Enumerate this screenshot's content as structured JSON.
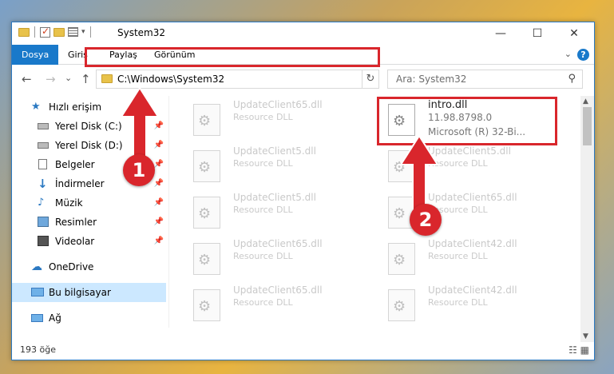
{
  "window": {
    "title": "System32",
    "minimize": "—",
    "maximize": "☐",
    "close": "✕"
  },
  "ribbon": {
    "tabs": [
      "Dosya",
      "Giriş",
      "Paylaş",
      "Görünüm"
    ],
    "help": "?"
  },
  "nav": {
    "back": "←",
    "forward": "→",
    "recent": "⌄",
    "up": "↑",
    "address": "C:\\Windows\\System32",
    "search_placeholder": "Ara: System32"
  },
  "sidebar": {
    "items": [
      {
        "label": "Hızlı erişim",
        "icon": "star-icon",
        "pinned": false
      },
      {
        "label": "Yerel Disk (C:)",
        "icon": "drive-icon",
        "pinned": true
      },
      {
        "label": "Yerel Disk (D:)",
        "icon": "drive-icon",
        "pinned": true
      },
      {
        "label": "Belgeler",
        "icon": "document-icon",
        "pinned": true
      },
      {
        "label": "İndirmeler",
        "icon": "download-icon",
        "pinned": true
      },
      {
        "label": "Müzik",
        "icon": "music-icon",
        "pinned": true
      },
      {
        "label": "Resimler",
        "icon": "pictures-icon",
        "pinned": true
      },
      {
        "label": "Videolar",
        "icon": "video-icon",
        "pinned": true
      },
      {
        "label": "OneDrive",
        "icon": "cloud-icon",
        "pinned": false
      },
      {
        "label": "Bu bilgisayar",
        "icon": "computer-icon",
        "pinned": false
      },
      {
        "label": "Ağ",
        "icon": "network-icon",
        "pinned": false
      }
    ]
  },
  "files": {
    "left": [
      {
        "name": "UpdateClient65.dll",
        "type": "Resource DLL"
      },
      {
        "name": "UpdateClient5.dll",
        "type": "Resource DLL"
      },
      {
        "name": "UpdateClient5.dll",
        "type": "Resource DLL"
      },
      {
        "name": "UpdateClient65.dll",
        "type": "Resource DLL"
      },
      {
        "name": "UpdateClient65.dll",
        "type": "Resource DLL"
      }
    ],
    "right": [
      {
        "name": "intro.dll",
        "version": "11.98.8798.0",
        "type": "Microsoft (R) 32-Bi..."
      },
      {
        "name": "UpdateClient5.dll",
        "type": "Resource DLL"
      },
      {
        "name": "UpdateClient65.dll",
        "type": "Resource DLL"
      },
      {
        "name": "UpdateClient42.dll",
        "type": "Resource DLL"
      },
      {
        "name": "UpdateClient42.dll",
        "type": "Resource DLL"
      }
    ]
  },
  "status": {
    "count": "193 öğe"
  },
  "annotations": {
    "step1": "1",
    "step2": "2",
    "color": "#d9262c"
  }
}
